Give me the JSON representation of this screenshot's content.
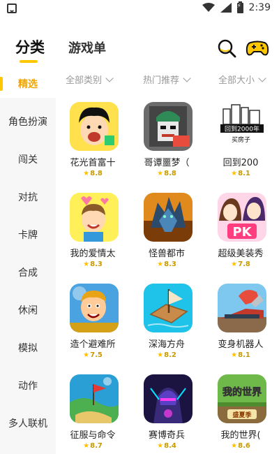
{
  "status_bar": {
    "time": "2:39"
  },
  "header": {
    "tab_active": "分类",
    "tab_other": "游戏单",
    "accent_color": "#ffc700"
  },
  "sidebar": {
    "items": [
      {
        "label": "精选",
        "active": true
      },
      {
        "label": "角色扮演",
        "active": false
      },
      {
        "label": "闯关",
        "active": false
      },
      {
        "label": "对抗",
        "active": false
      },
      {
        "label": "卡牌",
        "active": false
      },
      {
        "label": "合成",
        "active": false
      },
      {
        "label": "休闲",
        "active": false
      },
      {
        "label": "模拟",
        "active": false
      },
      {
        "label": "动作",
        "active": false
      },
      {
        "label": "多人联机",
        "active": false
      }
    ]
  },
  "filters": {
    "category": "全部类别",
    "sort": "热门推荐",
    "size": "全部大小"
  },
  "games": [
    {
      "name": "花光首富十",
      "rating": "8.8",
      "icon": "cartoon-man-icon"
    },
    {
      "name": "哥谭噩梦（",
      "rating": "8.8",
      "icon": "joker-icon"
    },
    {
      "name": "回到200",
      "rating": "8.1",
      "icon": "city-buildings-icon",
      "icon_text": "回到2000年",
      "icon_subtext": "买房子"
    },
    {
      "name": "我的爱情太",
      "rating": "8.3",
      "icon": "love-cartoon-icon"
    },
    {
      "name": "怪兽都市",
      "rating": "8.3",
      "icon": "monster-icon"
    },
    {
      "name": "超级美装秀",
      "rating": "7.8",
      "icon": "girls-pk-icon",
      "icon_text": "PK"
    },
    {
      "name": "造个避难所",
      "rating": "7.5",
      "icon": "shelter-man-icon"
    },
    {
      "name": "深海方舟",
      "rating": "8.2",
      "icon": "raft-icon"
    },
    {
      "name": "变身机器人",
      "rating": "8.1",
      "icon": "robot-train-icon"
    },
    {
      "name": "征服与命令",
      "rating": "8.7",
      "icon": "island-flag-icon"
    },
    {
      "name": "赛博奇兵",
      "rating": "8.4",
      "icon": "cyber-warrior-icon"
    },
    {
      "name": "我的世界(",
      "rating": "8.6",
      "icon": "minecraft-icon",
      "icon_text": "我的世界",
      "icon_subtext": "盛夏季"
    }
  ]
}
